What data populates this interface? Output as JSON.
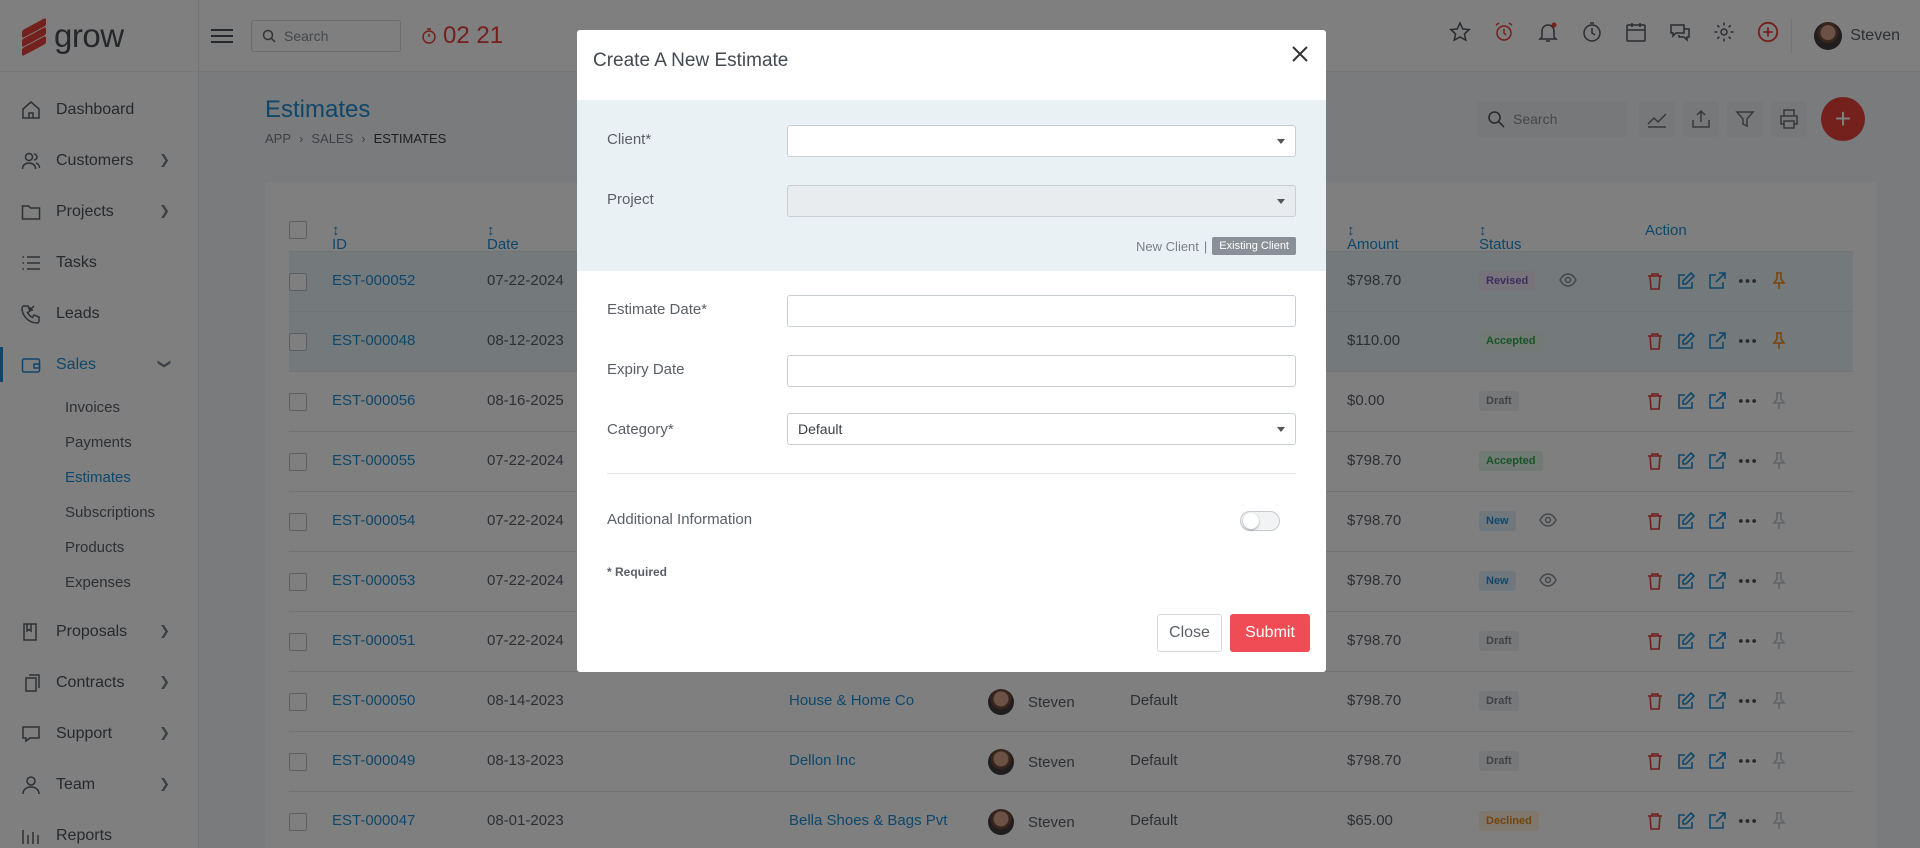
{
  "app": {
    "logo_text": "grow"
  },
  "topbar": {
    "search_placeholder": "Search",
    "timer": "02 21",
    "user_name": "Steven"
  },
  "sidebar": {
    "items": [
      {
        "label": "Dashboard"
      },
      {
        "label": "Customers"
      },
      {
        "label": "Projects"
      },
      {
        "label": "Tasks"
      },
      {
        "label": "Leads"
      },
      {
        "label": "Sales"
      },
      {
        "label": "Proposals"
      },
      {
        "label": "Contracts"
      },
      {
        "label": "Support"
      },
      {
        "label": "Team"
      },
      {
        "label": "Reports"
      }
    ],
    "sales_sub": [
      "Invoices",
      "Payments",
      "Estimates",
      "Subscriptions",
      "Products",
      "Expenses"
    ]
  },
  "page": {
    "title": "Estimates",
    "breadcrumb": [
      "APP",
      "SALES",
      "ESTIMATES"
    ],
    "search_placeholder": "Search"
  },
  "table": {
    "headers": {
      "id": "ID",
      "date": "Date",
      "amount": "Amount",
      "status": "Status",
      "action": "Action"
    },
    "rows": [
      {
        "id": "EST-000052",
        "date": "07-22-2024",
        "client": "",
        "creator": "",
        "category": "",
        "amount": "$798.70",
        "status": "Revised"
      },
      {
        "id": "EST-000048",
        "date": "08-12-2023",
        "client": "",
        "creator": "",
        "category": "",
        "amount": "$110.00",
        "status": "Accepted"
      },
      {
        "id": "EST-000056",
        "date": "08-16-2025",
        "client": "",
        "creator": "",
        "category": "",
        "amount": "$0.00",
        "status": "Draft"
      },
      {
        "id": "EST-000055",
        "date": "07-22-2024",
        "client": "",
        "creator": "",
        "category": "",
        "amount": "$798.70",
        "status": "Accepted"
      },
      {
        "id": "EST-000054",
        "date": "07-22-2024",
        "client": "",
        "creator": "",
        "category": "",
        "amount": "$798.70",
        "status": "New"
      },
      {
        "id": "EST-000053",
        "date": "07-22-2024",
        "client": "",
        "creator": "",
        "category": "",
        "amount": "$798.70",
        "status": "New"
      },
      {
        "id": "EST-000051",
        "date": "07-22-2024",
        "client": "",
        "creator": "",
        "category": "",
        "amount": "$798.70",
        "status": "Draft"
      },
      {
        "id": "EST-000050",
        "date": "08-14-2023",
        "client": "House & Home Co",
        "creator": "Steven",
        "category": "Default",
        "amount": "$798.70",
        "status": "Draft"
      },
      {
        "id": "EST-000049",
        "date": "08-13-2023",
        "client": "Dellon Inc",
        "creator": "Steven",
        "category": "Default",
        "amount": "$798.70",
        "status": "Draft"
      },
      {
        "id": "EST-000047",
        "date": "08-01-2023",
        "client": "Bella Shoes & Bags Pvt",
        "creator": "Steven",
        "category": "Default",
        "amount": "$65.00",
        "status": "Declined"
      }
    ]
  },
  "modal": {
    "title": "Create A New Estimate",
    "client_label": "Client*",
    "client_value": "",
    "project_label": "Project",
    "project_value": "",
    "new_client": "New Client",
    "separator": "|",
    "existing_client": "Existing Client",
    "estimate_date_label": "Estimate Date*",
    "estimate_date_value": "",
    "expiry_date_label": "Expiry Date",
    "expiry_date_value": "",
    "category_label": "Category*",
    "category_value": "Default",
    "additional_info_label": "Additional Information",
    "additional_info_enabled": false,
    "required_note": "* Required",
    "close_label": "Close",
    "submit_label": "Submit"
  },
  "colors": {
    "accent": "#1f8fd6",
    "brand_red": "#e8413a",
    "submit": "#ef4c56"
  }
}
